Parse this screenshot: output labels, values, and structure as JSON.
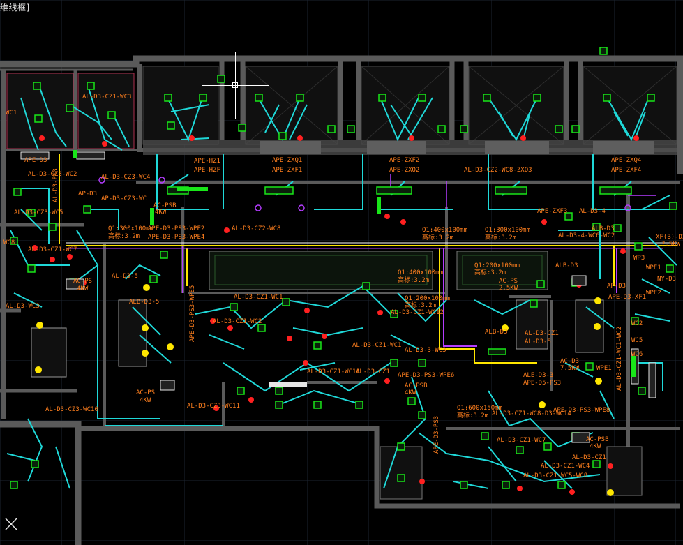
{
  "viewport": {
    "label": "维线框]",
    "colors": {
      "background": "#000000",
      "grid": "#1c2430",
      "wall": "#555555",
      "wall_dark": "#3c3c3c",
      "cyan": "#1fd8d8",
      "orange": "#ff7f1e",
      "green": "#19e619",
      "yellow": "#ffe600",
      "magenta": "#b43cff",
      "red": "#ff2020",
      "white": "#e6e6e6"
    }
  },
  "icons": [
    "ucs-icon",
    "crosshair-cursor-icon"
  ],
  "labels": {
    "wc1_top": "AL-D3-CZ1-WC3",
    "wc1_left": "WC1",
    "box_apb": "APE-D3",
    "cz3_wc2": "AL-D3-CZ3-WC2",
    "cz3_wc4": "AL-D3-CZ3-WC4",
    "ap_d3": "AP-D3",
    "ap_cz3": "AP-D3-CZ3-WC",
    "ps3": "AL-D3-PS3",
    "cz3_wc5": "AL-D3-CZ3-WC5",
    "wc8": "WC8",
    "cz1_wc7": "AL-D3-CZ1-WC7",
    "ac_ps": "AC-PS",
    "kw_4a": "4KW",
    "wc3_left": "AL-D3-WC3",
    "hz1": "APE-HZ1",
    "hzf": "APE-HZF",
    "zxq1": "APE-ZXQ1",
    "zxf1": "APE-ZXF1",
    "zxf2": "APE-ZXF2",
    "zxq2": "APE-ZXQ2",
    "cz2_zxq3": "AL-D3-CZ2-WC8-ZXQ3",
    "zxf3_top": "APE-ZXF3",
    "zxq4": "APE-ZXQ4",
    "zxf4": "APE-ZXF4",
    "ac_psb": "AC-PSB",
    "kw_4b": "4KW",
    "ps3_wpe2": "APE-D3-PS3-WPE2",
    "ps3_wpe4": "APE-D3-PS3-WPE4",
    "duct1": "Q1:300x100mm",
    "duct1_h": "高标:3.2m",
    "cz2_wc8": "AL-D3-CZ2-WC8",
    "duct2": "Q1:400x100mm",
    "duct2_h": "高标:3.2m",
    "duct3": "Q1:300x100mm",
    "duct3_h": "高标:3.2m",
    "zxf3": "APE-ZXF3",
    "al_d3_4": "AL-D3-4",
    "alb_d3": "ALB-D3",
    "al_d3_4_wc": "AL-D3-4-WC6-WC2",
    "duct_mid": "Q1:200x100mm",
    "duct_mid_h": "高标:3.2m",
    "duct_mid2": "Q1:400x100mm",
    "duct_mid2_h": "高标:3.2m",
    "wc2_right": "WC2",
    "ac_ps_right": "AC-PS",
    "kw_25": "2.5KW",
    "apb_d3": "AP-D3",
    "alb_d3_b": "ALB-D3",
    "ape_d3_xf1": "APE-D3-XF1",
    "wpe1": "WPE1",
    "wpe2": "WPE2",
    "xf_b_d3": "XF(B)-D3",
    "kw_75": "7.5KW",
    "wp3": "WP3",
    "ny_d3": "NY-D3",
    "al_d3_cz1_wc1": "AL-D3-CZ1-WC1",
    "al_d3_5": "AL-D3-5",
    "alb_d3_5": "ALB-D3-5",
    "al_d3_cz1_wc12": "AL-D3-CZ1-WC12",
    "ps3_wpe5": "APE-D3-PS3-WPE5",
    "al_d3_wc2_mid": "AL-D3-CZ1-WC2",
    "duct_c1": "Q1:200x100mm",
    "duct_c1_h": "高标:3.2m",
    "al_cz1_wc1b": "AL-D3-CZ1-WC1",
    "al_d3_3_wc3": "AL-D3-3-WC3",
    "al_d3_cz1_wc14": "AL-D3-CZ1-WC14",
    "al_d3_cz1_x": "AL-D3-CZ1",
    "ape_ps3_wpe6": "APE-D3-PS3-WPE6",
    "alb_d3_3": "ALB-D3",
    "al_d3_cz1": "AL-D3-CZ1",
    "al_d3_5b": "AL-D3-5",
    "ale_d3_3": "ALE-D3-3",
    "ape_d5_ps3": "APE-D5-PS3",
    "ac_psb2": "AC-PSB",
    "kw_4c": "4KW",
    "ac_ps_low": "AC-PS",
    "kw_4d": "4KW",
    "cz3_wc10": "AL-D3-CZ3-WC10",
    "cz3_wc11": "AL-D3-CZ3-WC11",
    "duct_low": "Q1:600x150mm",
    "duct_low_h": "高标:3.2m",
    "al_cz1_wc8": "AL-D3-CZ1-WC8-D3-WC14",
    "ape_ps3_wpe8": "APE-D3-PS3-WPE8",
    "al_cz1_wc7": "AL-D3-CZ1-WC7",
    "al_cz1_wc4": "AL-D3-CZ1-WC4",
    "al_cz1_wc5": "AL-D3-CZ1-WC5-WC8",
    "al_d3_cz1_r": "AL-D3-CZ1",
    "ac_psb3": "AC-PSB",
    "kw_4e": "4KW",
    "al_cz1_wc2_v": "AL-D3-CZ1-WC1-WC2",
    "wc5_r": "WC5",
    "wc6_r": "WC6",
    "wpe1_r": "WPE1",
    "ape_d3_ps3_v": "APE-D3-PS3",
    "ac_d3": "AC-D3",
    "ac_kw": "7.5KW"
  }
}
